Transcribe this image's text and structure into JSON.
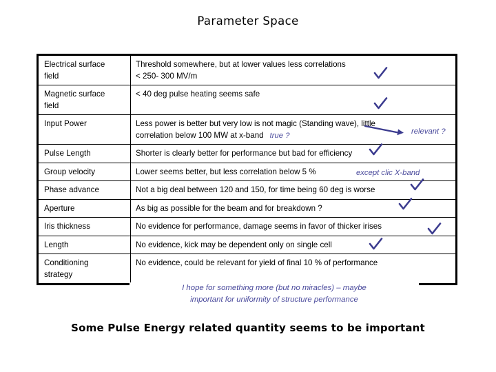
{
  "slide": {
    "title": "Parameter Space",
    "caption": "Some Pulse Energy related quantity seems to be important",
    "accent_blue": "#4a4a9c",
    "check_color": "#3b3b8f"
  },
  "table": {
    "rows": [
      {
        "name_line1": "Electrical surface",
        "name_line2": "field",
        "comment_line1": "Threshold somewhere, but at lower values less correlations",
        "comment_line2": "< 250- 300 MV/m",
        "check": true
      },
      {
        "name_line1": "Magnetic surface",
        "name_line2": "field",
        "comment_line1": "< 40 deg pulse heating seems safe",
        "comment_line2": "",
        "check": true
      },
      {
        "name_line1": "Input Power",
        "name_line2": "",
        "comment_line1": "Less power is better but very low is not magic (Standing wave), little",
        "comment_line2": "correlation below 100 MW at x-band",
        "annot_true": "true ?",
        "annot_relevant": "relevant ?",
        "check": false
      },
      {
        "name_line1": "Pulse Length",
        "name_line2": "",
        "comment_line1": "Shorter is clearly better for performance but bad for efficiency",
        "comment_line2": "",
        "check": true
      },
      {
        "name_line1": "Group velocity",
        "name_line2": "",
        "comment_line1": "Lower seems better, but less correlation below 5 %",
        "comment_line2": "",
        "annot_except": "except clic X-band",
        "check": false
      },
      {
        "name_line1": "Phase advance",
        "name_line2": "",
        "comment_line1": "Not a big deal between 120 and 150, for time being 60 deg is worse",
        "comment_line2": "",
        "check": true
      },
      {
        "name_line1": "Aperture",
        "name_line2": "",
        "comment_line1": "As big as possible for the beam and for breakdown ?",
        "comment_line2": "",
        "check": true
      },
      {
        "name_line1": "Iris thickness",
        "name_line2": "",
        "comment_line1": "No evidence for performance, damage seems in favor of thicker irises",
        "comment_line2": "",
        "check": true
      },
      {
        "name_line1": "Length",
        "name_line2": "",
        "comment_line1": "No evidence, kick may be dependent only on single cell",
        "comment_line2": "",
        "check": true
      },
      {
        "name_line1": "Conditioning",
        "name_line2": "strategy",
        "comment_line1": "No evidence, could be relevant for yield of final 10 % of performance",
        "comment_line2": "",
        "check": false
      }
    ],
    "conditioning_note_line1": "I hope for something more (but no miracles) – maybe",
    "conditioning_note_line2": "important for uniformity of structure performance"
  }
}
